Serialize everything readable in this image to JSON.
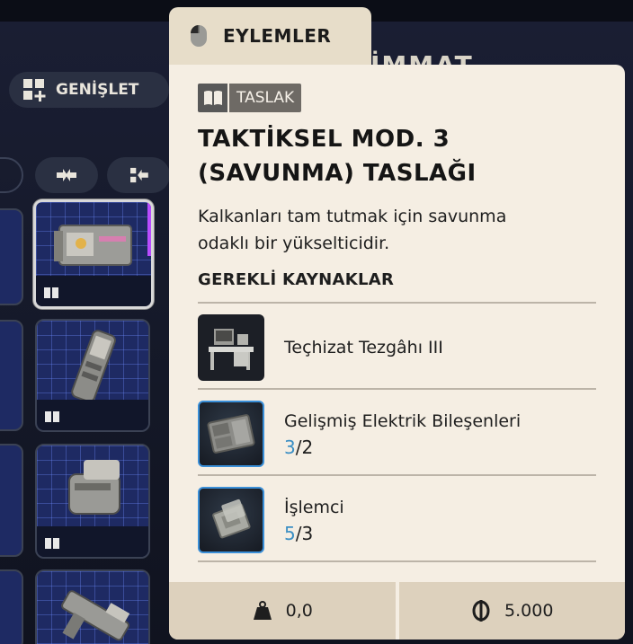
{
  "background": {
    "header_text": "İMMAT",
    "expand_label": "GENİŞLET"
  },
  "actions_tab": {
    "label": "EYLEMLER",
    "icon": "mouse-icon"
  },
  "tooltip": {
    "badge": "TASLAK",
    "title_line1": "TAKTİKSEL MOD. 3",
    "title_line2": "(SAVUNMA) TASLAĞI",
    "description_line1": "Kalkanları tam tutmak için savunma",
    "description_line2": "odaklı bir yükselticidir.",
    "resources_heading": "GEREKLİ KAYNAKLAR",
    "resources": [
      {
        "name": "Teçhizat Tezgâhı III",
        "icon": "workbench-icon"
      },
      {
        "name": "Gelişmiş Elektrik Bileşenleri",
        "have": "3",
        "need": "/2",
        "icon": "electrical-components-icon"
      },
      {
        "name": "İşlemci",
        "have": "5",
        "need": "/3",
        "icon": "processor-icon"
      }
    ],
    "footer": {
      "weight": "0,0",
      "price": "5.000"
    }
  },
  "colors": {
    "panel_bg": "#f5eee3",
    "tab_bg": "#e7ddc9",
    "count_accent": "#3b8fc4",
    "grid_cell": "#1e2a63",
    "rarity_purple": "#b84cff"
  }
}
